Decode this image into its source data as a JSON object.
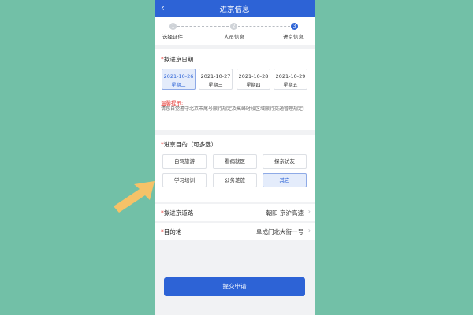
{
  "header": {
    "title": "进京信息",
    "back_icon": "chevron-left-icon"
  },
  "steps": [
    {
      "num": "1",
      "label": "选择证件",
      "active": false
    },
    {
      "num": "2",
      "label": "人员信息",
      "active": false
    },
    {
      "num": "3",
      "label": "进京信息",
      "active": true
    }
  ],
  "date_section": {
    "required_mark": "*",
    "title": "拟进京日期",
    "dates": [
      {
        "date": "2021-10-26",
        "weekday": "星期二",
        "selected": true
      },
      {
        "date": "2021-10-27",
        "weekday": "星期三",
        "selected": false
      },
      {
        "date": "2021-10-28",
        "weekday": "星期四",
        "selected": false
      },
      {
        "date": "2021-10-29",
        "weekday": "星期五",
        "selected": false
      }
    ],
    "tip_title": "温馨提示:",
    "tip_text": "请您自觉遵守北京市尾号限行规定及高峰时段区域限行交通管理规定!"
  },
  "purpose_section": {
    "required_mark": "*",
    "title": "进京目的（可多选）",
    "options": [
      {
        "label": "自驾旅游",
        "selected": false
      },
      {
        "label": "看病就医",
        "selected": false
      },
      {
        "label": "探亲访友",
        "selected": false
      },
      {
        "label": "学习培训",
        "selected": false
      },
      {
        "label": "公务差旅",
        "selected": false
      },
      {
        "label": "其它",
        "selected": true
      }
    ]
  },
  "road_row": {
    "required_mark": "*",
    "label": "拟进京道路",
    "value": "朝阳  京沪高速"
  },
  "destination_row": {
    "required_mark": "*",
    "label": "目的地",
    "value": "阜成门北大街一号"
  },
  "submit": {
    "label": "提交申请"
  },
  "colors": {
    "primary": "#2d63d6",
    "required": "#e5322d",
    "background": "#72c0a7",
    "arrow": "#f6c268"
  }
}
